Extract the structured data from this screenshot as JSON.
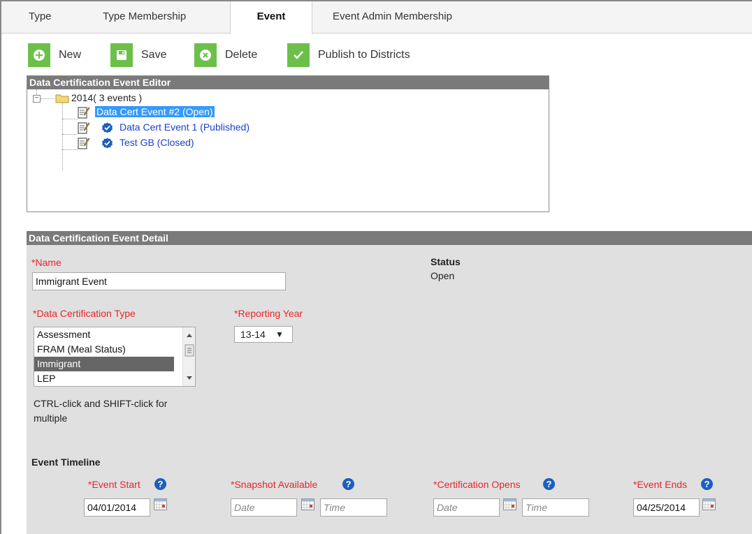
{
  "tabs": [
    {
      "label": "Type"
    },
    {
      "label": "Type Membership"
    },
    {
      "label": "Event"
    },
    {
      "label": "Event Admin Membership"
    }
  ],
  "toolbar": {
    "new_label": "New",
    "save_label": "Save",
    "delete_label": "Delete",
    "publish_label": "Publish to Districts"
  },
  "editor": {
    "title": "Data Certification Event Editor",
    "folder_label": "2014( 3 events )",
    "events": [
      {
        "label": "Data Cert Event #2 (Open)"
      },
      {
        "label": "Data Cert Event 1 (Published)"
      },
      {
        "label": "Test GB (Closed)"
      }
    ]
  },
  "detail": {
    "title": "Data Certification Event Detail",
    "name_label": "*Name",
    "name_value": "Immigrant Event",
    "status_label": "Status",
    "status_value": "Open",
    "type_label": "*Data Certification Type",
    "type_options": [
      {
        "label": "Assessment"
      },
      {
        "label": "FRAM (Meal Status)"
      },
      {
        "label": "Immigrant"
      },
      {
        "label": "LEP"
      }
    ],
    "type_selected": "Immigrant",
    "type_hint_line1": "CTRL-click and SHIFT-click for",
    "type_hint_line2": "multiple",
    "reporting_year_label": "*Reporting Year",
    "reporting_year_value": "13-14",
    "timeline_title": "Event Timeline",
    "event_start_label": "*Event Start",
    "event_start_value": "04/01/2014",
    "snapshot_label": "*Snapshot Available",
    "cert_opens_label": "*Certification Opens",
    "event_ends_label": "*Event Ends",
    "event_ends_value": "04/25/2014",
    "date_placeholder": "Date",
    "time_placeholder": "Time"
  },
  "colors": {
    "accent_green": "#6cc04a",
    "header_gray": "#7a7a7a",
    "required_red": "#e8262a",
    "link_blue": "#1a3fd1",
    "selected_blue": "#3399ff",
    "help_blue": "#1b5fbf"
  },
  "icons": [
    "plus-icon",
    "save-icon",
    "delete-icon",
    "check-icon",
    "folder-icon",
    "document-edit-icon",
    "published-check-icon",
    "help-icon",
    "calendar-icon"
  ]
}
